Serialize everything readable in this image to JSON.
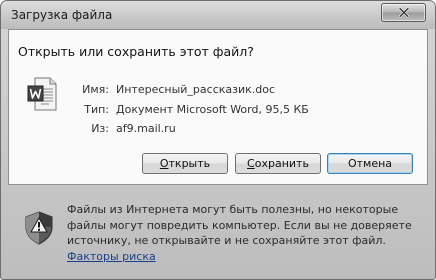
{
  "window": {
    "title": "Загрузка файла"
  },
  "dialog": {
    "heading": "Открыть или сохранить этот файл?",
    "file": {
      "name_label": "Имя:",
      "name_value": "Интересный_рассказик.doc",
      "type_label": "Тип:",
      "type_value": "Документ Microsoft Word, 95,5 КБ",
      "from_label": "Из:",
      "from_value": "af9.mail.ru",
      "icon": "word-document-icon"
    },
    "buttons": {
      "open": {
        "label_underlined": "О",
        "label_rest": "ткрыть"
      },
      "save": {
        "label_underlined": "С",
        "label_rest": "охранить"
      },
      "cancel": {
        "label": "Отмена"
      }
    }
  },
  "warning": {
    "icon": "shield-warning-icon",
    "text": "Файлы из Интернета могут быть полезны, но некоторые файлы могут повредить компьютер. Если вы не доверяете источнику, не открывайте и не сохраняйте этот файл.",
    "link": "Факторы риска"
  },
  "colors": {
    "accent": "#3c7fb1",
    "link": "#1a3f8a",
    "window_bg": "#c9c9c9"
  }
}
